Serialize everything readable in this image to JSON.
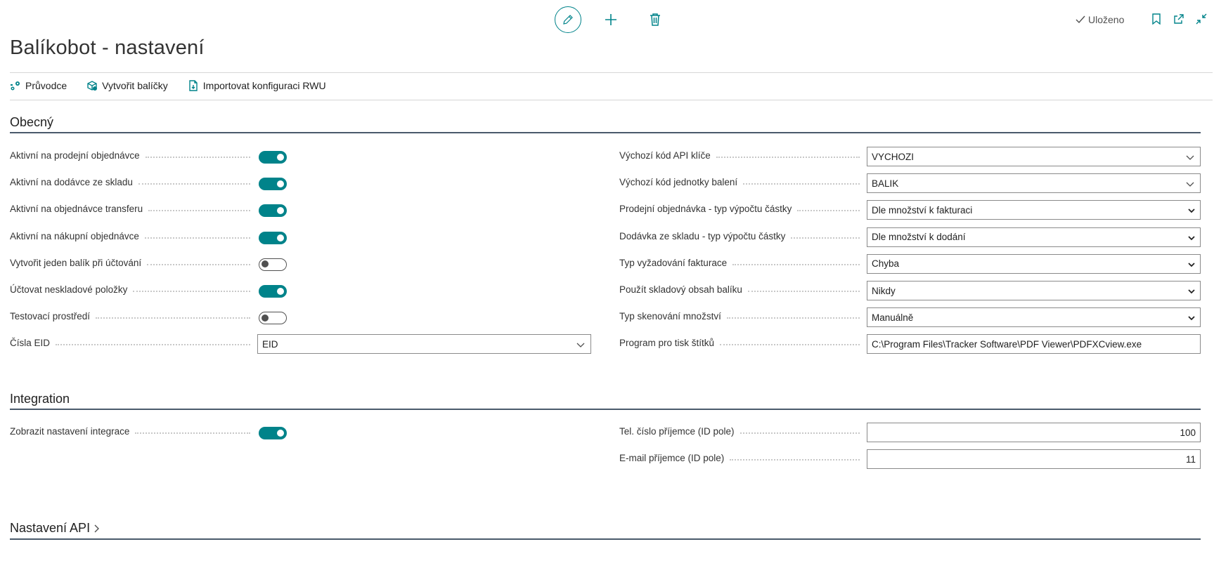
{
  "toolbar": {
    "saved_label": "Uloženo"
  },
  "page": {
    "title": "Balíkobot - nastavení"
  },
  "actions": [
    {
      "label": "Průvodce",
      "icon": "wizard-icon"
    },
    {
      "label": "Vytvořit balíčky",
      "icon": "create-packages-icon"
    },
    {
      "label": "Importovat konfiguraci RWU",
      "icon": "import-document-icon"
    }
  ],
  "sections": {
    "general": "Obecný",
    "integration": "Integration",
    "api": "Nastavení API"
  },
  "general_left": [
    {
      "label": "Aktivní na prodejní objednávce",
      "type": "toggle",
      "value": true
    },
    {
      "label": "Aktivní na dodávce ze skladu",
      "type": "toggle",
      "value": true
    },
    {
      "label": "Aktivní na objednávce transferu",
      "type": "toggle",
      "value": true
    },
    {
      "label": "Aktivní na nákupní objednávce",
      "type": "toggle",
      "value": true
    },
    {
      "label": "Vytvořit jeden balík při účtování",
      "type": "toggle",
      "value": false
    },
    {
      "label": "Účtovat neskladové položky",
      "type": "toggle",
      "value": true
    },
    {
      "label": "Testovací prostředí",
      "type": "toggle",
      "value": false
    },
    {
      "label": "Čísla EID",
      "type": "lookup",
      "value": "EID"
    }
  ],
  "general_right": [
    {
      "label": "Výchozí kód API klíče",
      "type": "lookup",
      "value": "VYCHOZI"
    },
    {
      "label": "Výchozí kód jednotky balení",
      "type": "lookup",
      "value": "BALIK"
    },
    {
      "label": "Prodejní objednávka - typ výpočtu částky",
      "type": "select",
      "value": "Dle množství k fakturaci"
    },
    {
      "label": "Dodávka ze skladu - typ výpočtu částky",
      "type": "select",
      "value": "Dle množství k dodání"
    },
    {
      "label": "Typ vyžadování fakturace",
      "type": "select",
      "value": "Chyba"
    },
    {
      "label": "Použít skladový obsah balíku",
      "type": "select",
      "value": "Nikdy"
    },
    {
      "label": "Typ skenování množství",
      "type": "select",
      "value": "Manuálně"
    },
    {
      "label": "Program pro tisk štítků",
      "type": "text",
      "value": "C:\\Program Files\\Tracker Software\\PDF Viewer\\PDFXCview.exe"
    }
  ],
  "integration_left": [
    {
      "label": "Zobrazit nastavení integrace",
      "type": "toggle",
      "value": true
    }
  ],
  "integration_right": [
    {
      "label": "Tel. číslo příjemce (ID pole)",
      "type": "number",
      "value": "100"
    },
    {
      "label": "E-mail příjemce (ID pole)",
      "type": "number",
      "value": "11"
    }
  ],
  "colors": {
    "accent": "#00838a",
    "section_line": "#4a5a6b"
  }
}
